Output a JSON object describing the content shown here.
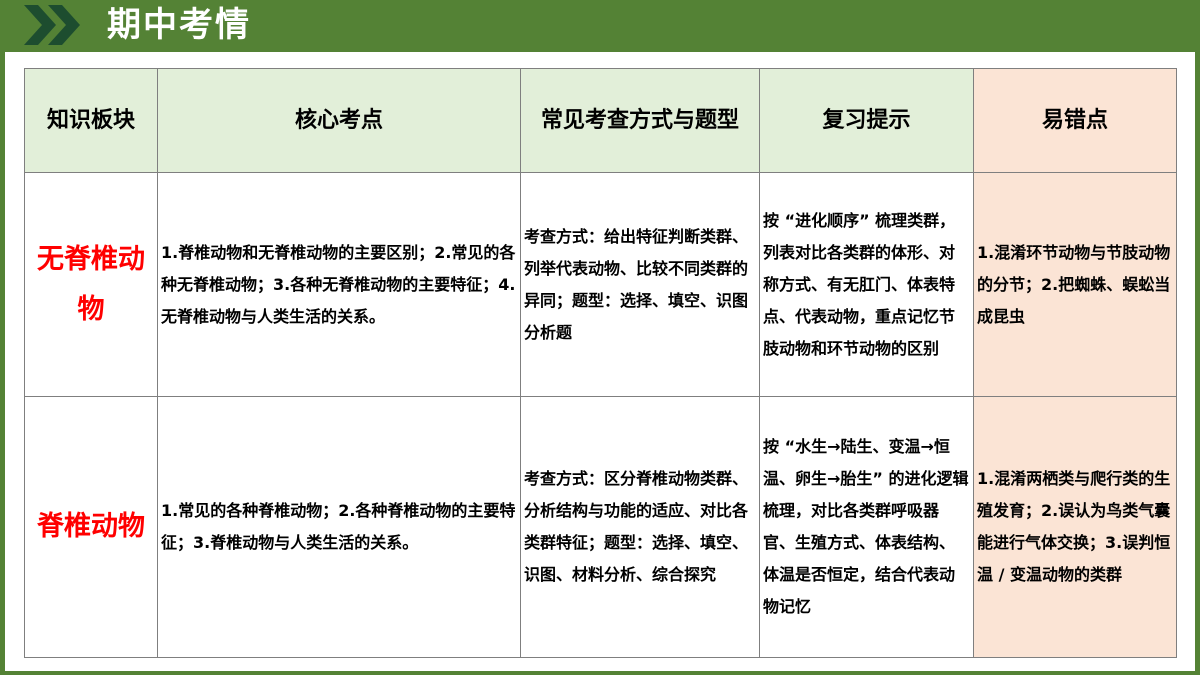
{
  "header": {
    "title": "期中考情",
    "icon": "double-chevron-right-icon",
    "color": "#548235"
  },
  "table": {
    "headers": [
      "知识板块",
      "核心考点",
      "常见考查方式与题型",
      "复习提示",
      "易错点"
    ],
    "rows": [
      {
        "category": "无脊椎动物",
        "core": "1.脊椎动物和无脊椎动物的主要区别；2.常见的各种无脊椎动物；3.各种无脊椎动物的主要特征；4.无脊椎动物与人类生活的关系。",
        "method": "考查方式：给出特征判断类群、列举代表动物、比较不同类群的异同；题型：选择、填空、识图分析题",
        "tips": "按 “进化顺序” 梳理类群，列表对比各类群的体形、对称方式、有无肛门、体表特点、代表动物，重点记忆节肢动物和环节动物的区别",
        "errors": "1.混淆环节动物与节肢动物的分节；2.把蜘蛛、蜈蚣当成昆虫"
      },
      {
        "category": "脊椎动物",
        "core": "1.常见的各种脊椎动物；2.各种脊椎动物的主要特征；3.脊椎动物与人类生活的关系。",
        "method": "考查方式：区分脊椎动物类群、分析结构与功能的适应、对比各类群特征；题型：选择、填空、识图、材料分析、综合探究",
        "tips": "按 “水生→陆生、变温→恒温、卵生→胎生” 的进化逻辑梳理，对比各类群呼吸器官、生殖方式、体表结构、体温是否恒定，结合代表动物记忆",
        "errors": "1.混淆两栖类与爬行类的生殖发育；2.误认为鸟类气囊能进行气体交换；3.误判恒温 / 变温动物的类群"
      }
    ]
  }
}
